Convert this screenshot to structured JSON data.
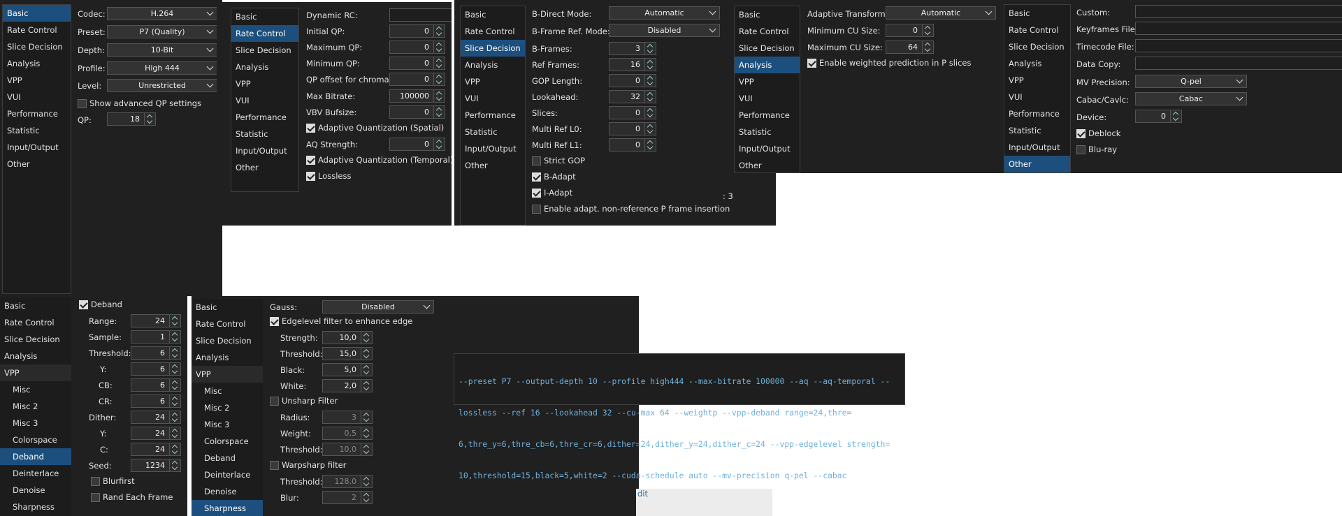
{
  "nav": {
    "basic": "Basic",
    "rate": "Rate Control",
    "slice": "Slice Decision",
    "analysis": "Analysis",
    "vpp": "VPP",
    "vui": "VUI",
    "perf": "Performance",
    "stat": "Statistic",
    "io": "Input/Output",
    "other": "Other",
    "misc": "Misc",
    "misc2": "Misc 2",
    "misc3": "Misc 3",
    "colorspace": "Colorspace",
    "deband": "Deband",
    "deinterlace": "Deinterlace",
    "denoise": "Denoise",
    "sharpness": "Sharpness"
  },
  "basic": {
    "codec_l": "Codec:",
    "codec": "H.264",
    "preset_l": "Preset:",
    "preset": "P7 (Quality)",
    "depth_l": "Depth:",
    "depth": "10-Bit",
    "profile_l": "Profile:",
    "profile": "High 444",
    "level_l": "Level:",
    "level": "Unrestricted",
    "adv_qp": "Show advanced QP settings",
    "qp_l": "QP:",
    "qp": "18"
  },
  "rate": {
    "dyn_l": "Dynamic RC:",
    "iqp_l": "Initial QP:",
    "iqp": "0",
    "maxqp_l": "Maximum QP:",
    "maxqp": "0",
    "minqp_l": "Minimum QP:",
    "minqp": "0",
    "chroma_l": "QP offset for chroma:",
    "chroma": "0",
    "maxbr_l": "Max Bitrate:",
    "maxbr": "100000",
    "vbv_l": "VBV Bufsize:",
    "vbv": "0",
    "aq_spatial": "Adaptive Quantization (Spatial)",
    "aqs_l": "AQ Strength:",
    "aqs": "0",
    "aq_temporal": "Adaptive Quantization (Temporal)",
    "lossless": "Lossless"
  },
  "slice": {
    "bdirect_l": "B-Direct Mode:",
    "bdirect": "Automatic",
    "bref_l": "B-Frame Ref. Mode:",
    "bref": "Disabled",
    "bframes_l": "B-Frames:",
    "bframes": "3",
    "ref_l": "Ref Frames:",
    "ref": "16",
    "gop_l": "GOP Length:",
    "gop": "0",
    "look_l": "Lookahead:",
    "look": "32",
    "slices_l": "Slices:",
    "slices": "0",
    "mr0_l": "Multi Ref L0:",
    "mr0": "0",
    "mr1_l": "Multi Ref L1:",
    "mr1": "0",
    "strict": "Strict GOP",
    "badapt": "B-Adapt",
    "iadapt": "I-Adapt",
    "nonref": "Enable adapt. non-reference P frame insertion",
    "frag": ": 3"
  },
  "analysis": {
    "at_l": "Adaptive Transform:",
    "at": "Automatic",
    "mincu_l": "Minimum CU Size:",
    "mincu": "0",
    "maxcu_l": "Maximum CU Size:",
    "maxcu": "64",
    "weightp": "Enable weighted prediction in P slices"
  },
  "other": {
    "custom_l": "Custom:",
    "kf_l": "Keyframes File:",
    "tc_l": "Timecode File:",
    "dc_l": "Data Copy:",
    "mv_l": "MV Precision:",
    "mv": "Q-pel",
    "cabac_l": "Cabac/Cavlc:",
    "cabac": "Cabac",
    "dev_l": "Device:",
    "dev": "0",
    "deblock": "Deblock",
    "bluray": "Blu-ray"
  },
  "deband": {
    "deband": "Deband",
    "range_l": "Range:",
    "range": "24",
    "sample_l": "Sample:",
    "sample": "1",
    "thr_l": "Threshold:",
    "thr": "6",
    "y_l": "Y:",
    "y": "6",
    "cb_l": "CB:",
    "cb": "6",
    "cr_l": "CR:",
    "cr": "6",
    "dither_l": "Dither:",
    "dither": "24",
    "dy_l": "Y:",
    "dy": "24",
    "dc_l": "C:",
    "dc": "24",
    "seed_l": "Seed:",
    "seed": "1234",
    "blurfirst": "Blurfirst",
    "rand": "Rand Each Frame"
  },
  "sharp": {
    "gauss_l": "Gauss:",
    "gauss": "Disabled",
    "edge": "Edgelevel filter to enhance edge",
    "str_l": "Strength:",
    "str": "10,0",
    "thr_l": "Threshold:",
    "thr": "15,0",
    "black_l": "Black:",
    "black": "5,0",
    "white_l": "White:",
    "white": "2,0",
    "unsharp": "Unsharp Filter",
    "rad_l": "Radius:",
    "rad": "3",
    "wt_l": "Weight:",
    "wt": "0,5",
    "uthr_l": "Threshold:",
    "uthr": "10,0",
    "warp": "Warpsharp filter",
    "wthr_l": "Threshold:",
    "wthr": "128,0",
    "blur_l": "Blur:",
    "blur": "2",
    "frag": "dit"
  },
  "cmd": {
    "line1": "--preset P7 --output-depth 10 --profile high444 --max-bitrate 100000 --aq --aq-temporal --",
    "line2": "lossless --ref 16 --lookahead 32 --cu-max 64 --weightp --vpp-deband range=24,thre=",
    "line3": "6,thre_y=6,thre_cb=6,thre_cr=6,dither=24,dither_y=24,dither_c=24 --vpp-edgelevel strength=",
    "line4": "10,threshold=15,black=5,white=2 --cuda-schedule auto --mv-precision q-pel --cabac"
  }
}
